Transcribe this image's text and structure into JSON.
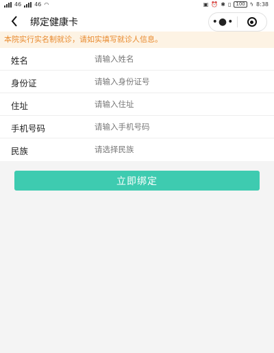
{
  "status_bar": {
    "network_left": "46",
    "network_right": "46",
    "battery": "100",
    "time": "8:38"
  },
  "nav": {
    "title": "绑定健康卡",
    "more_icon": "more-dots-icon",
    "close_icon": "target-icon"
  },
  "notice": {
    "text": "本院实行实名制就诊，请如实填写就诊人信息。",
    "color": "#e88a2e"
  },
  "form": {
    "fields": [
      {
        "label": "姓名",
        "placeholder": "请输入姓名"
      },
      {
        "label": "身份证",
        "placeholder": "请输入身份证号"
      },
      {
        "label": "住址",
        "placeholder": "请输入住址"
      },
      {
        "label": "手机号码",
        "placeholder": "请输入手机号码"
      },
      {
        "label": "民族",
        "placeholder": "请选择民族"
      }
    ]
  },
  "submit": {
    "label": "立即绑定",
    "color": "#3ecbb0"
  }
}
